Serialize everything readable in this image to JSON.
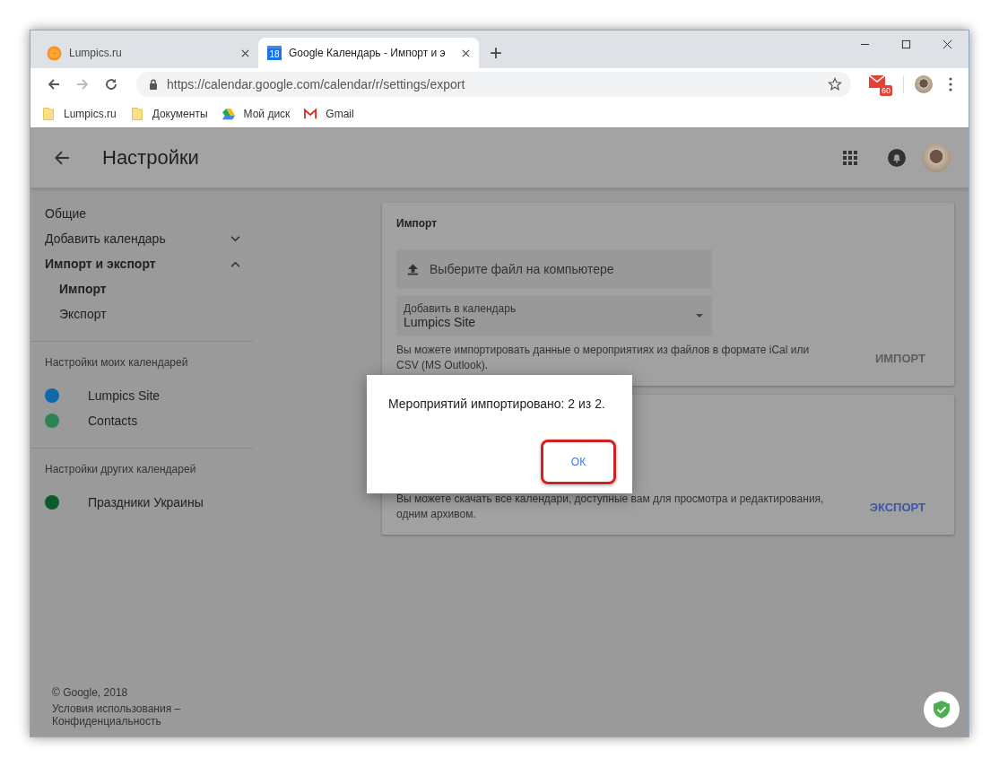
{
  "browser": {
    "tabs": [
      {
        "title": "Lumpics.ru",
        "selected": false,
        "kind": "orange"
      },
      {
        "title": "Google Календарь - Импорт и э",
        "selected": true,
        "kind": "calendar"
      }
    ],
    "favicon_date": "18",
    "new_tab": "+",
    "url": "https://calendar.google.com/calendar/r/settings/export",
    "mail_count": "60",
    "bookmarks": [
      {
        "label": "Lumpics.ru",
        "kind": "folder"
      },
      {
        "label": "Документы",
        "kind": "folder"
      },
      {
        "label": "Мой диск",
        "kind": "drive"
      },
      {
        "label": "Gmail",
        "kind": "gmail"
      }
    ]
  },
  "app_bar": {
    "title": "Настройки"
  },
  "sidebar": {
    "items": [
      {
        "label": "Общие"
      },
      {
        "label": "Добавить календарь",
        "expanded": false
      },
      {
        "label": "Импорт и экспорт",
        "expanded": true,
        "children": [
          {
            "label": "Импорт",
            "selected": true
          },
          {
            "label": "Экспорт",
            "selected": false
          }
        ]
      }
    ],
    "sections": [
      {
        "heading": "Настройки моих календарей",
        "calendars": [
          {
            "name": "Lumpics Site",
            "color": "#0b6aa7"
          },
          {
            "name": "Contacts",
            "color": "#2a8552"
          }
        ]
      },
      {
        "heading": "Настройки других календарей",
        "calendars": [
          {
            "name": "Праздники Украины",
            "color": "#0a5c2b"
          }
        ]
      }
    ]
  },
  "import_card": {
    "title": "Импорт",
    "upload": "Выберите файл на компьютере",
    "select_label": "Добавить в календарь",
    "select_value": "Lumpics Site",
    "description": "Вы можете импортировать данные о мероприятиях из файлов в формате iCal или CSV (MS Outlook).",
    "button": "ИМПОРТ",
    "button_disabled": true
  },
  "export_card": {
    "description": "Вы можете скачать все календари, доступные вам для просмотра и редактирования, одним архивом.",
    "button": "ЭКСПОРТ",
    "button_disabled": false
  },
  "dialog": {
    "message": "Мероприятий импортировано: 2 из 2.",
    "button": "ОК",
    "highlighted": true
  },
  "footer": {
    "copyright": "© Google, 2018",
    "terms": "Условия использования –",
    "privacy": "Конфиденциальность"
  }
}
